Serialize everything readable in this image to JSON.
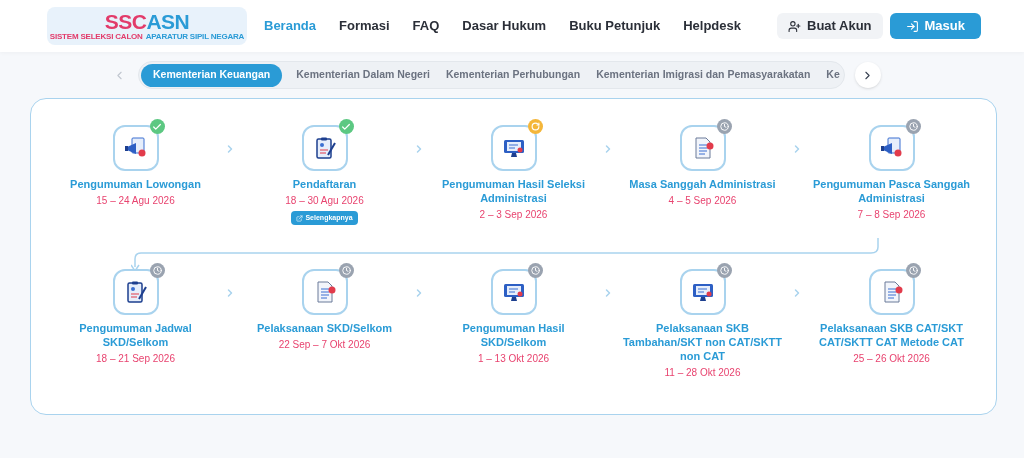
{
  "logo": {
    "part_1": "SSC",
    "part_2": "ASN",
    "tagline_1": "SISTEM SELEKSI CALON",
    "tagline_2": "APARATUR SIPIL NEGARA"
  },
  "nav": [
    {
      "label": "Beranda",
      "selected": true
    },
    {
      "label": "Formasi",
      "selected": false
    },
    {
      "label": "FAQ",
      "selected": false
    },
    {
      "label": "Dasar Hukum",
      "selected": false
    },
    {
      "label": "Buku Petunjuk",
      "selected": false
    },
    {
      "label": "Helpdesk",
      "selected": false
    }
  ],
  "buttons": [
    {
      "label": "Buat Akun",
      "kind": "secondary"
    },
    {
      "label": "Masuk",
      "kind": "primary"
    }
  ],
  "agency_tabs": [
    {
      "label": "Kementerian Keuangan",
      "selected": true
    },
    {
      "label": "Kementerian Dalam Negeri",
      "selected": false
    },
    {
      "label": "Kementerian Perhubungan",
      "selected": false
    },
    {
      "label": "Kementerian Imigrasi dan Pemasyarakatan",
      "selected": false
    },
    {
      "label": "Ke",
      "selected": false
    }
  ],
  "steps": [
    {
      "title": "Pengumuman Lowongan",
      "date": "15 – 24 Agu 2026",
      "kind": "done"
    },
    {
      "title": "Pendaftaran",
      "date": "18 – 30 Agu 2026",
      "kind": "done",
      "link": "Selengkapnya"
    },
    {
      "title": "Pengumuman Hasil Seleksi Administrasi",
      "date": "2 – 3 Sep 2026",
      "kind": "in_progress"
    },
    {
      "title": "Masa Sanggah Administrasi",
      "date": "4 – 5 Sep 2026",
      "kind": "upcoming"
    },
    {
      "title": "Pengumuman Pasca Sanggah Administrasi",
      "date": "7 – 8 Sep 2026",
      "kind": "upcoming"
    },
    {
      "title": "Pengumuman Jadwal SKD/Selkom",
      "date": "18 – 21 Sep 2026",
      "kind": "upcoming"
    },
    {
      "title": "Pelaksanaan SKD/Selkom",
      "date": "22 Sep – 7 Okt 2026",
      "kind": "upcoming"
    },
    {
      "title": "Pengumuman Hasil SKD/Selkom",
      "date": "1 – 13 Okt 2026",
      "kind": "upcoming"
    },
    {
      "title": "Pelaksanaan SKB Tambahan/SKT non CAT/SKTT non CAT",
      "date": "11 – 28 Okt 2026",
      "kind": "upcoming"
    },
    {
      "title": "Pelaksanaan SKB CAT/SKT CAT/SKTT CAT Metode CAT",
      "date": "25 – 26 Okt 2026",
      "kind": "upcoming"
    }
  ]
}
